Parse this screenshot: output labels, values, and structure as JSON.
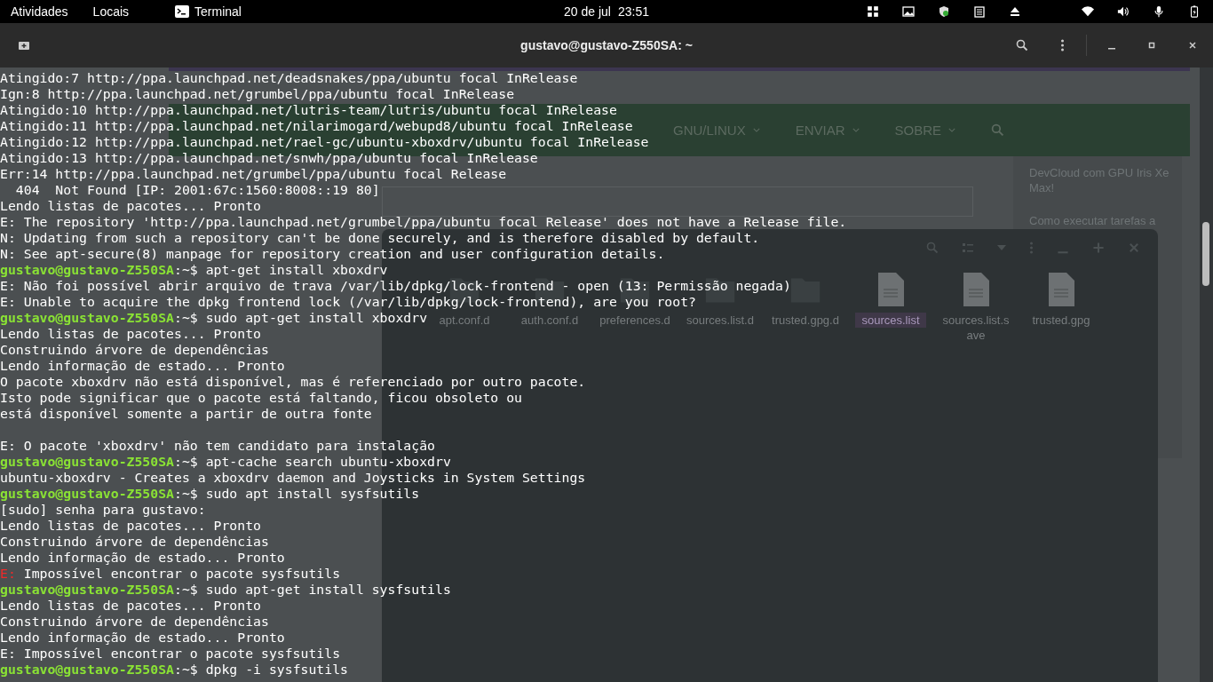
{
  "top_bar": {
    "activities": "Atividades",
    "places": "Locais",
    "app": "Terminal",
    "date": "20 de jul",
    "time": "23:51"
  },
  "window": {
    "title": "gustavo@gustavo-Z550SA: ~"
  },
  "background": {
    "nav_items": [
      "GNU/LINUX",
      "ENVIAR",
      "SOBRE"
    ],
    "sidebar_links": [
      "DevCloud com GPU Iris Xe Max!",
      "Como executar tarefas a"
    ],
    "files": [
      {
        "name": "apt.conf.d",
        "kind": "folder",
        "selected": false
      },
      {
        "name": "auth.conf.d",
        "kind": "folder",
        "selected": false
      },
      {
        "name": "preferences.d",
        "kind": "folder",
        "selected": false
      },
      {
        "name": "sources.list.d",
        "kind": "folder",
        "selected": false
      },
      {
        "name": "trusted.gpg.d",
        "kind": "folder",
        "selected": false
      },
      {
        "name": "sources.list",
        "kind": "file",
        "selected": true
      },
      {
        "name": "sources.list.save",
        "kind": "file",
        "selected": false
      },
      {
        "name": "trusted.gpg",
        "kind": "file",
        "selected": false
      }
    ]
  },
  "terminal_lines": [
    {
      "kind": "output",
      "text": "Atingido:7 http://ppa.launchpad.net/deadsnakes/ppa/ubuntu focal InRelease"
    },
    {
      "kind": "output",
      "text": "Ign:8 http://ppa.launchpad.net/grumbel/ppa/ubuntu focal InRelease"
    },
    {
      "kind": "output",
      "text": "Atingido:10 http://ppa.launchpad.net/lutris-team/lutris/ubuntu focal InRelease"
    },
    {
      "kind": "output",
      "text": "Atingido:11 http://ppa.launchpad.net/nilarimogard/webupd8/ubuntu focal InRelease"
    },
    {
      "kind": "output",
      "text": "Atingido:12 http://ppa.launchpad.net/rael-gc/ubuntu-xboxdrv/ubuntu focal InRelease"
    },
    {
      "kind": "output",
      "text": "Atingido:13 http://ppa.launchpad.net/snwh/ppa/ubuntu focal InRelease"
    },
    {
      "kind": "output",
      "text": "Err:14 http://ppa.launchpad.net/grumbel/ppa/ubuntu focal Release"
    },
    {
      "kind": "output",
      "text": "  404  Not Found [IP: 2001:67c:1560:8008::19 80]"
    },
    {
      "kind": "output",
      "text": "Lendo listas de pacotes... Pronto"
    },
    {
      "kind": "output",
      "text": "E: The repository 'http://ppa.launchpad.net/grumbel/ppa/ubuntu focal Release' does not have a Release file."
    },
    {
      "kind": "output",
      "text": "N: Updating from such a repository can't be done securely, and is therefore disabled by default."
    },
    {
      "kind": "output",
      "text": "N: See apt-secure(8) manpage for repository creation and user configuration details."
    },
    {
      "kind": "prompt",
      "user": "gustavo@gustavo-Z550SA",
      "text": ":~$ apt-get install xboxdrv"
    },
    {
      "kind": "output",
      "text": "E: Não foi possível abrir arquivo de trava /var/lib/dpkg/lock-frontend - open (13: Permissão negada)"
    },
    {
      "kind": "output",
      "text": "E: Unable to acquire the dpkg frontend lock (/var/lib/dpkg/lock-frontend), are you root?"
    },
    {
      "kind": "prompt",
      "user": "gustavo@gustavo-Z550SA",
      "text": ":~$ sudo apt-get install xboxdrv"
    },
    {
      "kind": "output",
      "text": "Lendo listas de pacotes... Pronto"
    },
    {
      "kind": "output",
      "text": "Construindo árvore de dependências"
    },
    {
      "kind": "output",
      "text": "Lendo informação de estado... Pronto"
    },
    {
      "kind": "output",
      "text": "O pacote xboxdrv não está disponível, mas é referenciado por outro pacote."
    },
    {
      "kind": "output",
      "text": "Isto pode significar que o pacote está faltando, ficou obsoleto ou"
    },
    {
      "kind": "output",
      "text": "está disponível somente a partir de outra fonte"
    },
    {
      "kind": "blank"
    },
    {
      "kind": "output",
      "text": "E: O pacote 'xboxdrv' não tem candidato para instalação"
    },
    {
      "kind": "prompt",
      "user": "gustavo@gustavo-Z550SA",
      "text": ":~$ apt-cache search ubuntu-xboxdrv"
    },
    {
      "kind": "output",
      "text": "ubuntu-xboxdrv - Creates a xboxdrv daemon and Joysticks in System Settings"
    },
    {
      "kind": "prompt",
      "user": "gustavo@gustavo-Z550SA",
      "text": ":~$ sudo apt install sysfsutils"
    },
    {
      "kind": "output",
      "text": "[sudo] senha para gustavo:"
    },
    {
      "kind": "output",
      "text": "Lendo listas de pacotes... Pronto"
    },
    {
      "kind": "output",
      "text": "Construindo árvore de dependências"
    },
    {
      "kind": "output",
      "text": "Lendo informação de estado... Pronto"
    },
    {
      "kind": "error",
      "tag": "E:",
      "text": " Impossível encontrar o pacote sysfsutils"
    },
    {
      "kind": "prompt",
      "user": "gustavo@gustavo-Z550SA",
      "text": ":~$ sudo apt-get install sysfsutils"
    },
    {
      "kind": "output",
      "text": "Lendo listas de pacotes... Pronto"
    },
    {
      "kind": "output",
      "text": "Construindo árvore de dependências"
    },
    {
      "kind": "output",
      "text": "Lendo informação de estado... Pronto"
    },
    {
      "kind": "output",
      "text": "E: Impossível encontrar o pacote sysfsutils"
    },
    {
      "kind": "prompt",
      "user": "gustavo@gustavo-Z550SA",
      "text": ":~$ dpkg -i sysfsutils"
    }
  ]
}
